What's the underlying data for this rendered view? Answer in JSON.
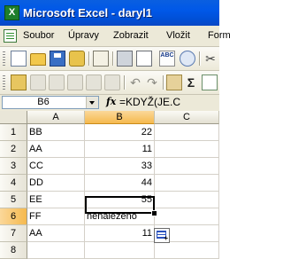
{
  "window": {
    "title": "Microsoft Excel - daryl1",
    "app_icon_glyph": "X"
  },
  "menu": {
    "items": [
      "Soubor",
      "Úpravy",
      "Zobrazit",
      "Vložit",
      "Form"
    ]
  },
  "toolbar1": {
    "icons": [
      "new-icon",
      "open-icon",
      "save-icon",
      "permission-icon",
      "email-icon",
      "print-icon",
      "print-preview-icon",
      "spelling-icon",
      "research-icon",
      "cut-icon"
    ]
  },
  "toolbar2": {
    "icons": [
      "ink-icon",
      "reply-icon",
      "track-icon",
      "review-icon",
      "compare-icon",
      "mail-recipient-icon",
      "undo-icon",
      "redo-icon",
      "hyperlink-icon",
      "autosum-icon",
      "sheet-icon",
      "sort-icon"
    ]
  },
  "formula_bar": {
    "name_box": "B6",
    "fx": "fx",
    "formula": "=KDYŽ(JE.C"
  },
  "grid": {
    "columns": [
      "A",
      "B",
      "C"
    ],
    "rows": [
      {
        "num": "1",
        "a": "BB",
        "b": "22"
      },
      {
        "num": "2",
        "a": "AA",
        "b": "11"
      },
      {
        "num": "3",
        "a": "CC",
        "b": "33"
      },
      {
        "num": "4",
        "a": "DD",
        "b": "44"
      },
      {
        "num": "5",
        "a": "EE",
        "b": "55"
      },
      {
        "num": "6",
        "a": "FF",
        "b": "nenalezeno"
      },
      {
        "num": "7",
        "a": "AA",
        "b": "11"
      },
      {
        "num": "8",
        "a": "",
        "b": ""
      }
    ],
    "active_cell": "B6"
  }
}
